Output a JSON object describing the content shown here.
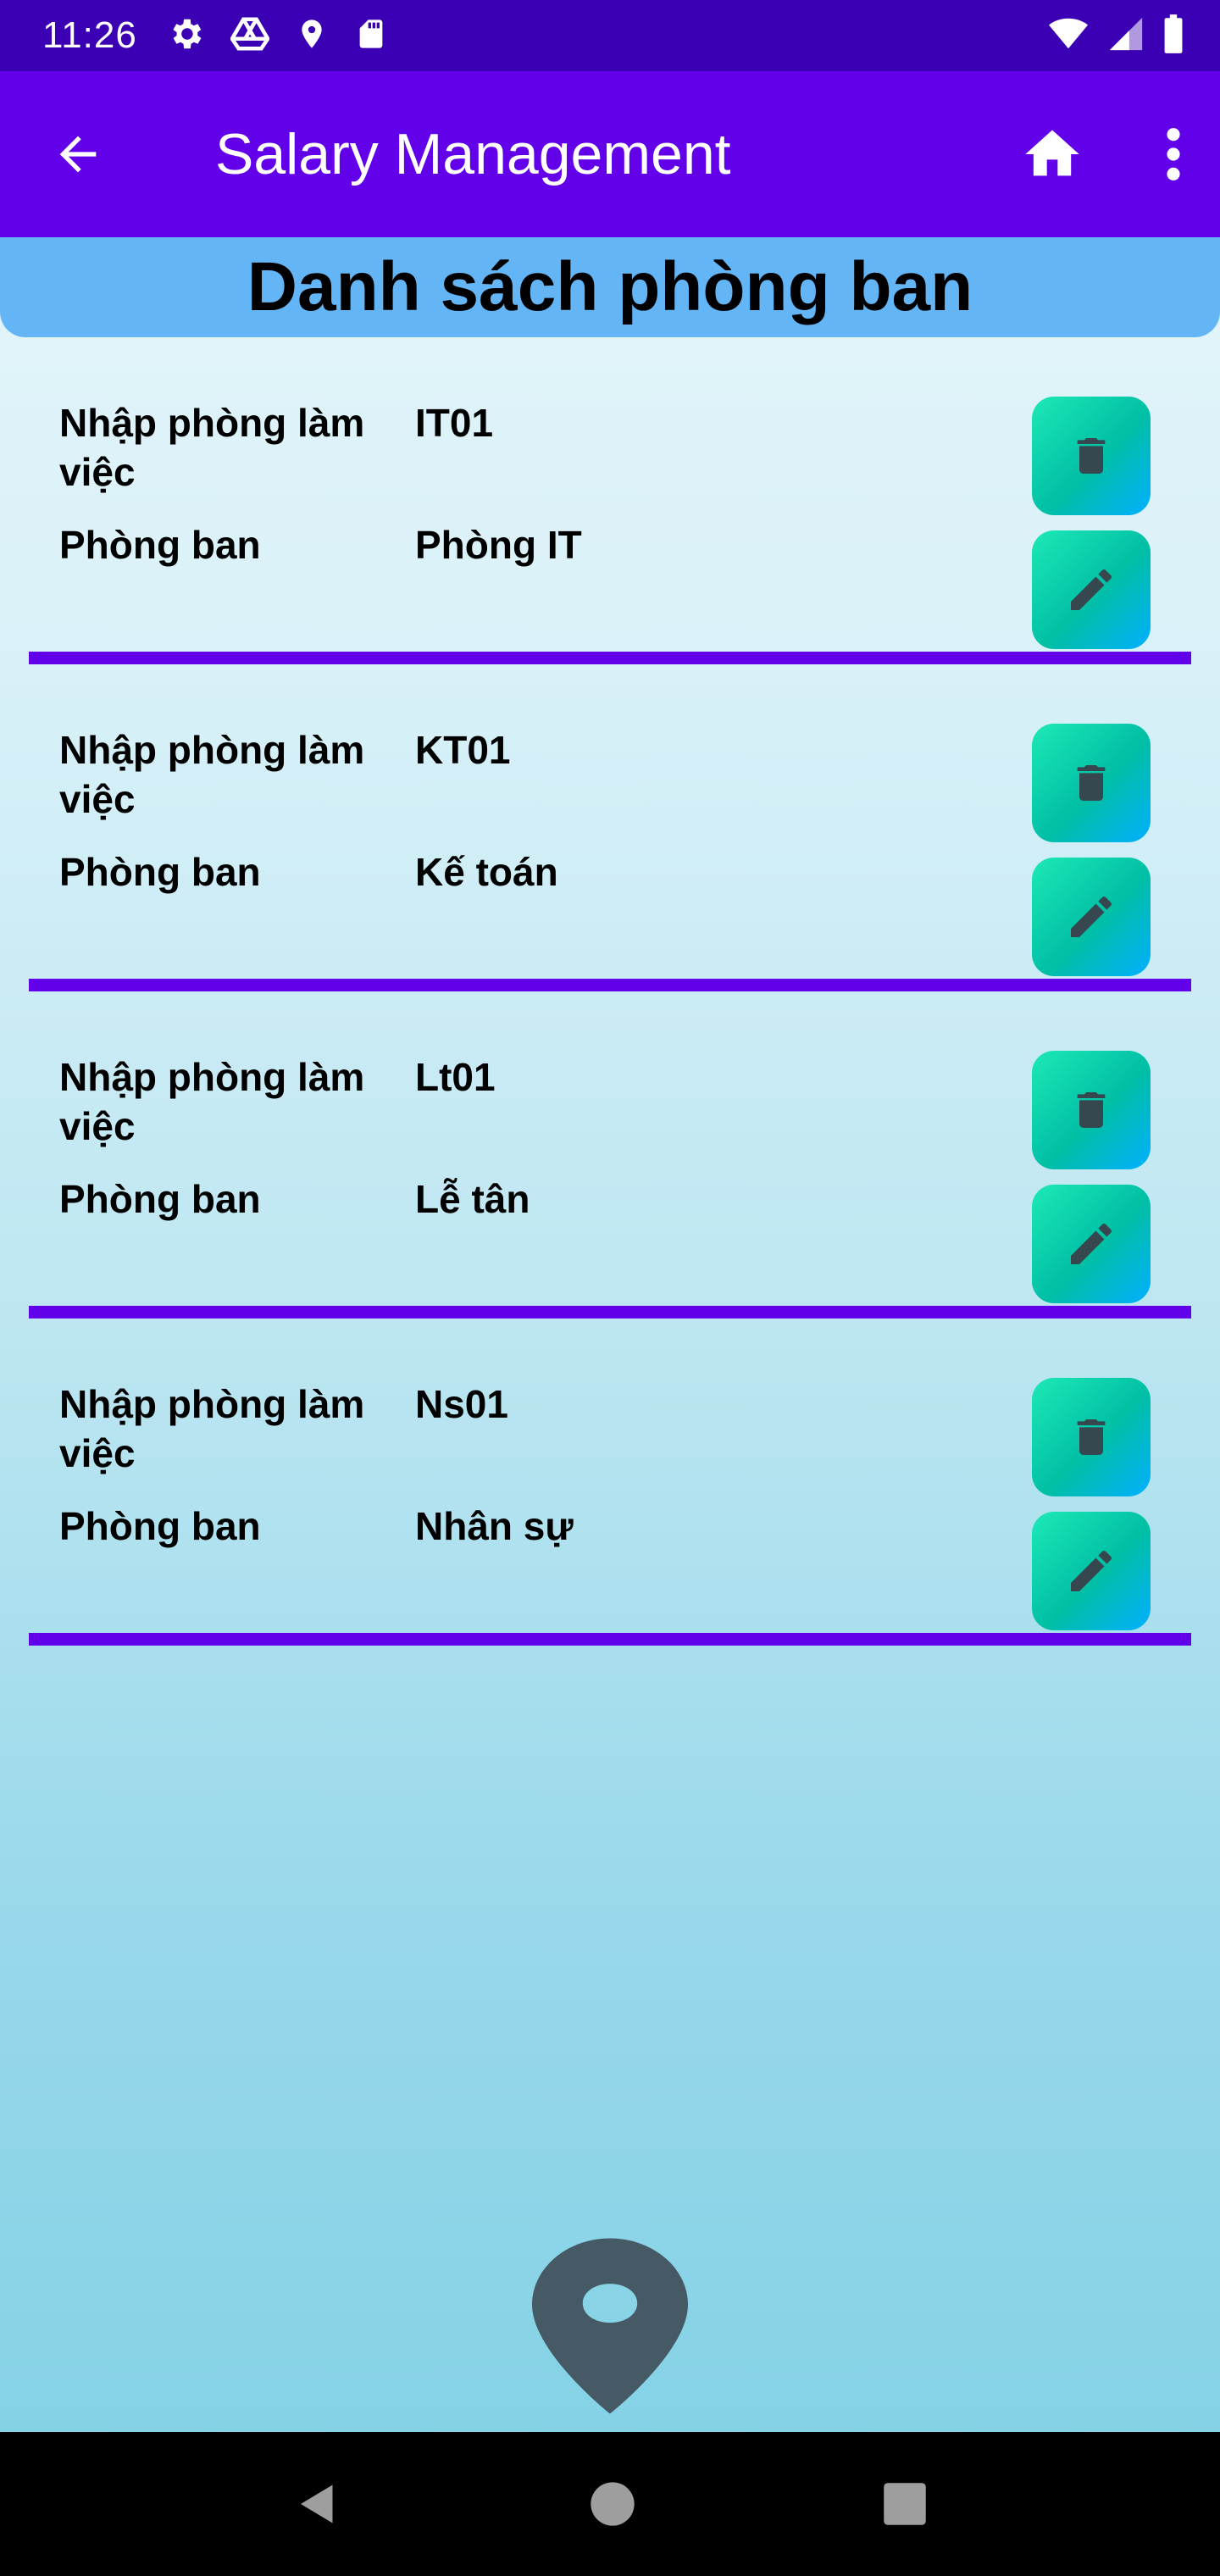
{
  "status_bar": {
    "time": "11:26",
    "left_icons": [
      "settings-icon",
      "drive-icon",
      "location-icon",
      "sd-card-icon"
    ],
    "right_icons": [
      "wifi-icon",
      "signal-icon",
      "battery-icon"
    ]
  },
  "app_bar": {
    "title": "Salary Management",
    "back_icon": "arrow-back-icon",
    "home_icon": "home-icon",
    "more_icon": "more-vert-icon"
  },
  "list": {
    "heading": "Danh sách phòng ban",
    "items": [
      {
        "code_label": "Nhập phòng làm việc",
        "code": "IT01",
        "name_label": "Phòng ban",
        "name": "Phòng IT"
      },
      {
        "code_label": "Nhập phòng làm việc",
        "code": "KT01",
        "name_label": "Phòng ban",
        "name": "Kế toán"
      },
      {
        "code_label": "Nhập phòng làm việc",
        "code": "Lt01",
        "name_label": "Phòng ban",
        "name": "Lễ tân"
      },
      {
        "code_label": "Nhập phòng làm việc",
        "code": "Ns01",
        "name_label": "Phòng ban",
        "name": "Nhân sự"
      }
    ]
  },
  "colors": {
    "status_bar": "#3c00b4",
    "app_bar": "#6200ea",
    "header": "#64b5f6",
    "divider": "#6200ea",
    "button_gradient_start": "#1de9b6",
    "button_gradient_end": "#00b0ff",
    "icon_dark": "#37474f"
  },
  "fab": {
    "icon": "location-pin-icon"
  },
  "nav_bar": {
    "icons": [
      "nav-back-icon",
      "nav-home-icon",
      "nav-recents-icon"
    ]
  }
}
